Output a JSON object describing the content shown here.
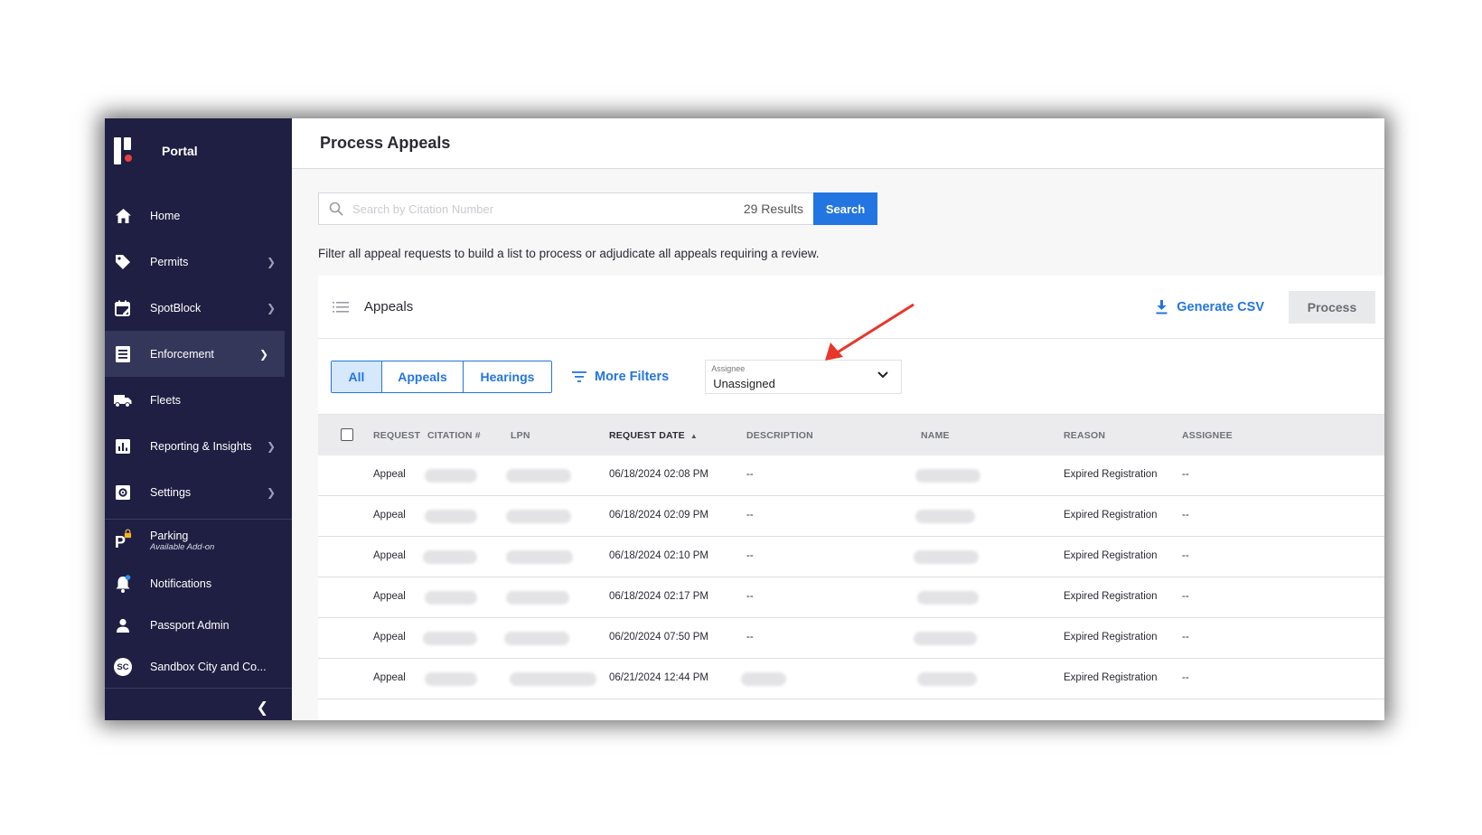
{
  "sidebar": {
    "brand": "Portal",
    "items": [
      {
        "label": "Home",
        "icon": "home-icon"
      },
      {
        "label": "Permits",
        "icon": "tag-icon"
      },
      {
        "label": "SpotBlock",
        "icon": "calendar-edit-icon"
      },
      {
        "label": "Enforcement",
        "icon": "document-icon"
      },
      {
        "label": "Fleets",
        "icon": "truck-icon"
      },
      {
        "label": "Reporting & Insights",
        "icon": "chart-icon"
      },
      {
        "label": "Settings",
        "icon": "gear-icon"
      }
    ],
    "addon": {
      "title": "Parking",
      "subtitle": "Available Add-on"
    },
    "notifications": "Notifications",
    "passport_admin": "Passport Admin",
    "org": {
      "initials": "SC",
      "name": "Sandbox City and Co..."
    }
  },
  "header": {
    "title": "Process Appeals"
  },
  "search": {
    "placeholder": "Search by Citation Number",
    "results": "29 Results",
    "button": "Search"
  },
  "help_text": "Filter all appeal requests to build a list to process or adjudicate all appeals requiring a review.",
  "card": {
    "title": "Appeals",
    "generate_csv": "Generate CSV",
    "process": "Process"
  },
  "filters": {
    "segments": [
      "All",
      "Appeals",
      "Hearings"
    ],
    "selected": "All",
    "more_filters": "More Filters",
    "assignee_label": "Assignee",
    "assignee_value": "Unassigned"
  },
  "table": {
    "columns": [
      "REQUEST",
      "CITATION #",
      "LPN",
      "REQUEST DATE",
      "DESCRIPTION",
      "NAME",
      "REASON",
      "ASSIGNEE"
    ],
    "rows": [
      {
        "request": "Appeal",
        "date": "06/18/2024 02:08 PM",
        "description": "--",
        "reason": "Expired Registration",
        "assignee": "--"
      },
      {
        "request": "Appeal",
        "date": "06/18/2024 02:09 PM",
        "description": "--",
        "reason": "Expired Registration",
        "assignee": "--"
      },
      {
        "request": "Appeal",
        "date": "06/18/2024 02:10 PM",
        "description": "--",
        "reason": "Expired Registration",
        "assignee": "--"
      },
      {
        "request": "Appeal",
        "date": "06/18/2024 02:17 PM",
        "description": "--",
        "reason": "Expired Registration",
        "assignee": "--"
      },
      {
        "request": "Appeal",
        "date": "06/20/2024 07:50 PM",
        "description": "--",
        "reason": "Expired Registration",
        "assignee": "--"
      },
      {
        "request": "Appeal",
        "date": "06/21/2024 12:44 PM",
        "description": "",
        "reason": "Expired Registration",
        "assignee": "--"
      }
    ]
  },
  "colors": {
    "sidebar_bg": "#1e1f42",
    "accent": "#2375e1",
    "annotation_arrow": "#e8372a"
  }
}
